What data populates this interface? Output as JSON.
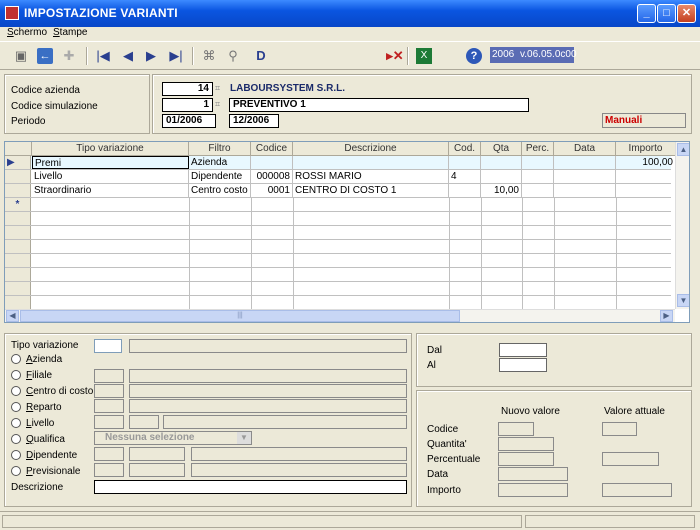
{
  "window": {
    "title": "IMPOSTAZIONE VARIANTI",
    "min_label": "_",
    "max_label": "□",
    "close_label": "✕"
  },
  "menu": [
    "Schermo",
    "Stampe"
  ],
  "toolbar": {
    "version_left": "2006",
    "version_right": "v.06.05.0c00"
  },
  "header": {
    "codice_azienda_label": "Codice azienda",
    "codice_simulazione_label": "Codice simulazione",
    "periodo_label": "Periodo",
    "azienda_code": "14",
    "azienda_name": "LABOURSYSTEM S.R.L.",
    "simulazione_code": "1",
    "simulazione_name": "PREVENTIVO 1",
    "periodo_dal": "01/2006",
    "periodo_al": "12/2006",
    "mode_badge": "Manuali"
  },
  "grid": {
    "columns": [
      "Tipo variazione",
      "Filtro",
      "Codice",
      "Descrizione",
      "Cod.",
      "Qta",
      "Perc.",
      "Data",
      "Importo"
    ],
    "rows": [
      [
        "Premi",
        "Azienda",
        "",
        "",
        "",
        "",
        "",
        "",
        "100,00"
      ],
      [
        "Livello",
        "Dipendente",
        "000008",
        "ROSSI MARIO",
        "4",
        "",
        "",
        "",
        ""
      ],
      [
        "Straordinario",
        "Centro costo",
        "0001",
        "CENTRO DI COSTO 1",
        "",
        "10,00",
        "",
        "",
        ""
      ]
    ],
    "scroll_thumb": "|||"
  },
  "filters": {
    "tipo_variazione_label": "Tipo variazione",
    "options": [
      "Azienda",
      "Filiale",
      "Centro di costo",
      "Reparto",
      "Livello",
      "Qualifica",
      "Dipendente",
      "Previsionale"
    ],
    "qualifica_placeholder": "Nessuna selezione",
    "descrizione_label": "Descrizione"
  },
  "dates": {
    "dal_label": "Dal",
    "al_label": "Al"
  },
  "values": {
    "nuovo_valore_label": "Nuovo valore",
    "valore_attuale_label": "Valore attuale",
    "rows": [
      "Codice",
      "Quantita'",
      "Percentuale",
      "Data",
      "Importo"
    ]
  },
  "colors": {
    "titlebar": "#0a55e0",
    "badge_text": "#cc0000",
    "version_bg": "#5a6cb4"
  }
}
